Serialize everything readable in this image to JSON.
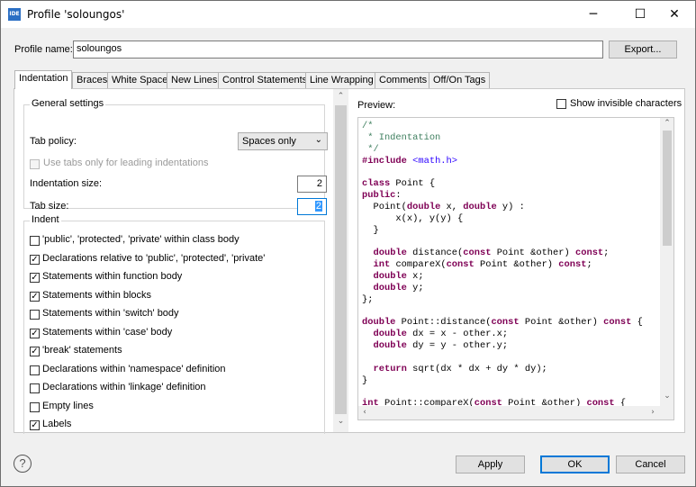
{
  "window": {
    "title": "Profile 'soloungos'",
    "app_icon": "IDE",
    "min": "─",
    "max": "☐",
    "close": "✕"
  },
  "profile": {
    "label": "Profile name:",
    "value": "soloungos",
    "export_label": "Export..."
  },
  "tabs": [
    "Indentation",
    "Braces",
    "White Space",
    "New Lines",
    "Control Statements",
    "Line Wrapping",
    "Comments",
    "Off/On Tags"
  ],
  "general": {
    "title": "General settings",
    "tab_policy_label": "Tab policy:",
    "tab_policy_value": "Spaces only",
    "leading_label": "Use tabs only for leading indentations",
    "indent_size_label": "Indentation size:",
    "indent_size_value": "2",
    "tab_size_label": "Tab size:",
    "tab_size_value": "2"
  },
  "indent": {
    "title": "Indent",
    "items": [
      {
        "label": "'public', 'protected', 'private' within class body",
        "checked": false
      },
      {
        "label": "Declarations relative to 'public', 'protected', 'private'",
        "checked": true
      },
      {
        "label": "Statements within function body",
        "checked": true
      },
      {
        "label": "Statements within blocks",
        "checked": true
      },
      {
        "label": "Statements within 'switch' body",
        "checked": false
      },
      {
        "label": "Statements within 'case' body",
        "checked": true
      },
      {
        "label": "'break' statements",
        "checked": true
      },
      {
        "label": "Declarations within 'namespace' definition",
        "checked": false
      },
      {
        "label": "Declarations within 'linkage' definition",
        "checked": false
      },
      {
        "label": "Empty lines",
        "checked": false
      },
      {
        "label": "Labels",
        "checked": true
      }
    ]
  },
  "preview": {
    "label": "Preview:",
    "show_invisible_label": "Show invisible characters",
    "code": [
      [
        [
          "/*",
          "cm"
        ]
      ],
      [
        [
          " * Indentation",
          "cm"
        ]
      ],
      [
        [
          " */",
          "cm"
        ]
      ],
      [
        [
          "#include ",
          "kw"
        ],
        [
          "<math.h>",
          "inc"
        ]
      ],
      [],
      [
        [
          "class ",
          "kw"
        ],
        [
          "Point {",
          ""
        ]
      ],
      [
        [
          "public",
          "kw"
        ],
        [
          ":",
          ""
        ]
      ],
      [
        [
          "  Point(",
          ""
        ],
        [
          "double",
          "kw"
        ],
        [
          " x, ",
          ""
        ],
        [
          "double",
          "kw"
        ],
        [
          " y) :",
          ""
        ]
      ],
      [
        [
          "      x(x), y(y) {",
          ""
        ]
      ],
      [
        [
          "  }",
          ""
        ]
      ],
      [],
      [
        [
          "  ",
          ""
        ],
        [
          "double",
          "kw"
        ],
        [
          " distance(",
          ""
        ],
        [
          "const",
          "kw"
        ],
        [
          " Point &other) ",
          ""
        ],
        [
          "const",
          "kw"
        ],
        [
          ";",
          ""
        ]
      ],
      [
        [
          "  ",
          ""
        ],
        [
          "int",
          "kw"
        ],
        [
          " compareX(",
          ""
        ],
        [
          "const",
          "kw"
        ],
        [
          " Point &other) ",
          ""
        ],
        [
          "const",
          "kw"
        ],
        [
          ";",
          ""
        ]
      ],
      [
        [
          "  ",
          ""
        ],
        [
          "double",
          "kw"
        ],
        [
          " x;",
          ""
        ]
      ],
      [
        [
          "  ",
          ""
        ],
        [
          "double",
          "kw"
        ],
        [
          " y;",
          ""
        ]
      ],
      [
        [
          "};",
          ""
        ]
      ],
      [],
      [
        [
          "double",
          "kw"
        ],
        [
          " Point::distance(",
          ""
        ],
        [
          "const",
          "kw"
        ],
        [
          " Point &other) ",
          ""
        ],
        [
          "const",
          "kw"
        ],
        [
          " {",
          ""
        ]
      ],
      [
        [
          "  ",
          ""
        ],
        [
          "double",
          "kw"
        ],
        [
          " dx = x - other.x;",
          ""
        ]
      ],
      [
        [
          "  ",
          ""
        ],
        [
          "double",
          "kw"
        ],
        [
          " dy = y - other.y;",
          ""
        ]
      ],
      [],
      [
        [
          "  ",
          ""
        ],
        [
          "return",
          "kw"
        ],
        [
          " sqrt(dx * dx + dy * dy);",
          ""
        ]
      ],
      [
        [
          "}",
          ""
        ]
      ],
      [],
      [
        [
          "int",
          "kw"
        ],
        [
          " Point::compareX(",
          ""
        ],
        [
          "const",
          "kw"
        ],
        [
          " Point &other) ",
          ""
        ],
        [
          "const",
          "kw"
        ],
        [
          " {",
          ""
        ]
      ]
    ]
  },
  "footer": {
    "help_icon": "?",
    "apply": "Apply",
    "ok": "OK",
    "cancel": "Cancel"
  }
}
